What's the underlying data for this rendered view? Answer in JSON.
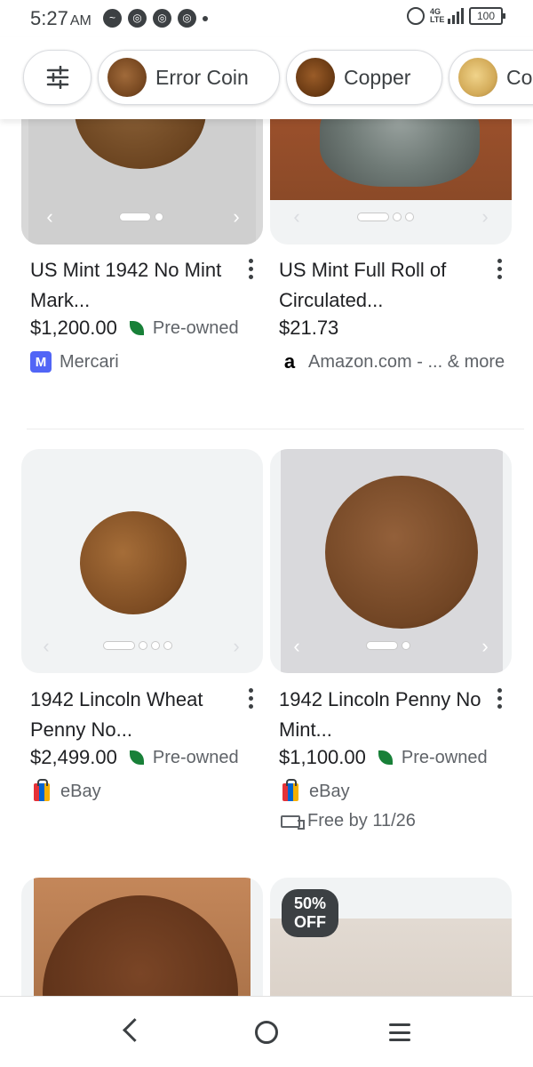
{
  "status_bar": {
    "time": "5:27",
    "ampm": "AM",
    "network": "4G LTE",
    "battery": "100"
  },
  "chips": [
    {
      "label": "",
      "icon": "filter-sliders-icon"
    },
    {
      "label": "Error Coin",
      "icon": "coin-thumbnail"
    },
    {
      "label": "Copper",
      "icon": "coin-thumbnail"
    },
    {
      "label": "Co",
      "icon": "coin-thumbnail"
    }
  ],
  "products": [
    {
      "title": "US Mint 1942 No Mint Mark...",
      "price": "$1,200.00",
      "condition": "Pre-owned",
      "seller": "Mercari",
      "seller_icon": "M",
      "dots": 2,
      "active_dot": 1
    },
    {
      "title": "US Mint Full Roll of Circulated...",
      "price": "$21.73",
      "condition": "",
      "seller": "Amazon.com - ... & more",
      "seller_icon": "a",
      "dots": 3,
      "active_dot": 1
    },
    {
      "title": "1942 Lincoln Wheat Penny No...",
      "price": "$2,499.00",
      "condition": "Pre-owned",
      "seller": "eBay",
      "dots": 4,
      "active_dot": 1
    },
    {
      "title": "1942 Lincoln Penny No Mint...",
      "price": "$1,100.00",
      "condition": "Pre-owned",
      "seller": "eBay",
      "shipping": "Free by 11/26",
      "dots": 2,
      "active_dot": 1
    },
    {
      "title": "",
      "price": "",
      "condition": "",
      "seller": ""
    },
    {
      "badge": "50% OFF"
    }
  ],
  "nav": {
    "back": "back-icon",
    "home": "home-icon",
    "recents": "menu-icon"
  }
}
